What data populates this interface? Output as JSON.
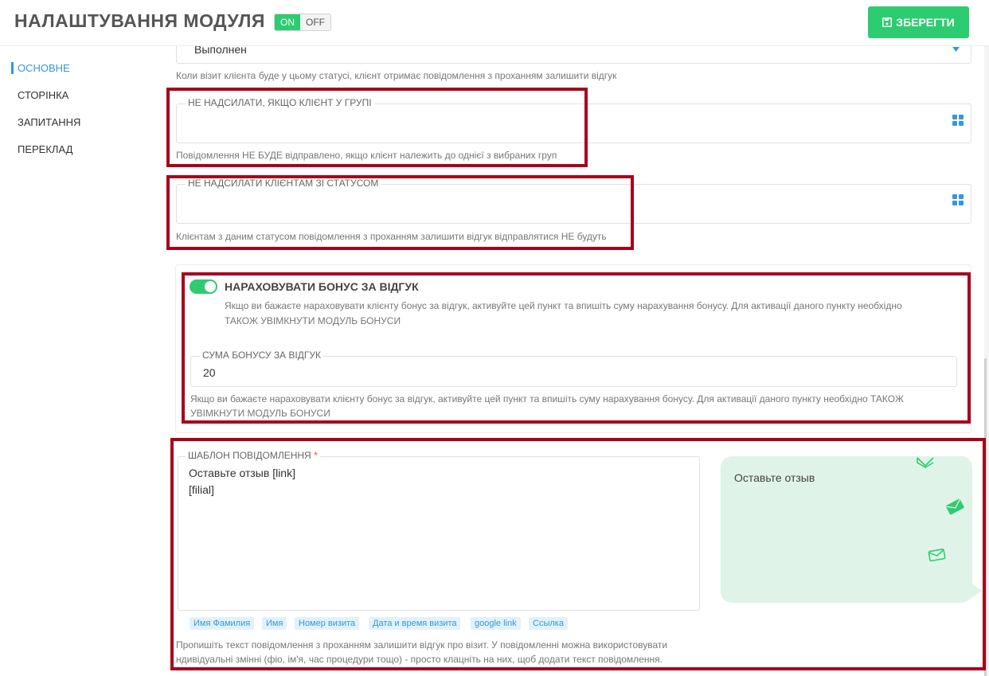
{
  "header": {
    "title": "НАЛАШТУВАННЯ МОДУЛЯ",
    "toggle_on": "ON",
    "toggle_off": "OFF",
    "save_label": "ЗБЕРЕГТИ"
  },
  "sidebar": {
    "items": [
      {
        "label": "ОСНОВНЕ",
        "active": true
      },
      {
        "label": "СТОРІНКА",
        "active": false
      },
      {
        "label": "ЗАПИТАННЯ",
        "active": false
      },
      {
        "label": "ПЕРЕКЛАД",
        "active": false
      }
    ]
  },
  "status_select": {
    "value": "Выполнен",
    "help": "Коли візит клієнта буде у цьому статусі, клієнт отримає повідомлення з проханням залишити відгук"
  },
  "exclude_groups": {
    "label": "НЕ НАДСИЛАТИ, ЯКЩО КЛІЄНТ У ГРУПІ",
    "help": "Повідомлення НЕ БУДЕ відправлено, якщо клієнт належить до однієї з вибраних груп"
  },
  "exclude_status": {
    "label": "НЕ НАДСИЛАТИ КЛІЄНТАМ ЗІ СТАТУСОМ",
    "help": "Клієнтам з даним статусом повідомлення з проханням залишити відгук відправлятися НЕ будуть"
  },
  "bonus": {
    "enabled": true,
    "title": "НАРАХОВУВАТИ БОНУС ЗА ВІДГУК",
    "description_line1": "Якщо ви бажаєте нараховувати клієнту бонус за відгук, активуйте цей пункт та впишіть суму нарахування бонусу. Для активації даного пункту необхідно",
    "description_line2": "ТАКОЖ УВІМКНУТИ МОДУЛЬ БОНУСИ",
    "amount_label": "СУМА БОНУСУ ЗА ВІДГУК",
    "amount_value": "20",
    "help_line1": "Якщо ви бажаєте нараховувати клієнту бонус за відгук, активуйте цей пункт та впишіть суму нарахування бонусу. Для активації даного пункту необхідно ТАКОЖ",
    "help_line2": "УВІМКНУТИ МОДУЛЬ БОНУСИ"
  },
  "template": {
    "label": "ШАБЛОН ПОВІДОМЛЕННЯ",
    "required_mark": "*",
    "value": "Оставьте отзыв [link]\n[filial]",
    "chips": [
      "Имя Фамилия",
      "Имя",
      "Номер визита",
      "Дата и время визита",
      "google link",
      "Ссылка"
    ],
    "help_line1": "Пропишіть текст повідомлення з проханням залишити відгук про візит. У повідомленні можна використовувати",
    "help_line2": "ндивідуальні змінні (фіо, ім'я, час процедури тощо) - просто клацніть на них, щоб додати текст повідомлення."
  },
  "preview": {
    "text": "Оставьте отзыв"
  },
  "colors": {
    "accent_green": "#2ecc71",
    "link_blue": "#3498db",
    "highlight_red": "#a8001c",
    "preview_bg": "#dff3e8"
  }
}
